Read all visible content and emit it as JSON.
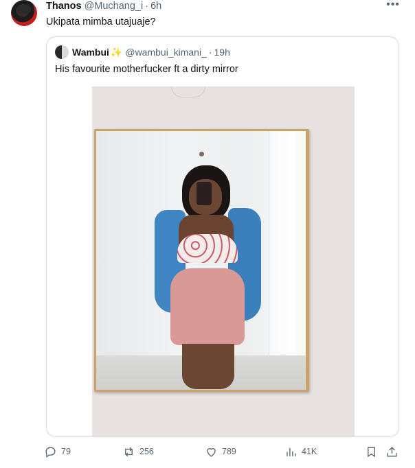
{
  "tweet": {
    "author_name": "Thanos",
    "author_handle": "@Muchang_i",
    "separator": "·",
    "time": "6h",
    "text": "Ukipata mimba utajuaje?",
    "more_icon": "more-horizontal-icon",
    "more_label": "•••"
  },
  "quoted": {
    "author_name": "Wambui",
    "sparkle": "✨",
    "author_handle": "@wambui_kimani_",
    "separator": "·",
    "time": "19h",
    "text": "His favourite motherfucker ft a dirty mirror"
  },
  "actions": {
    "replies": "79",
    "retweets": "256",
    "likes": "789",
    "views": "41K",
    "icons": [
      "reply-icon",
      "retweet-icon",
      "like-icon",
      "views-icon",
      "bookmark-icon",
      "share-icon"
    ]
  },
  "colors": {
    "text_primary": "#0f1419",
    "text_secondary": "#536471",
    "border": "#cfd9de",
    "sparkle": "#f4b400"
  }
}
